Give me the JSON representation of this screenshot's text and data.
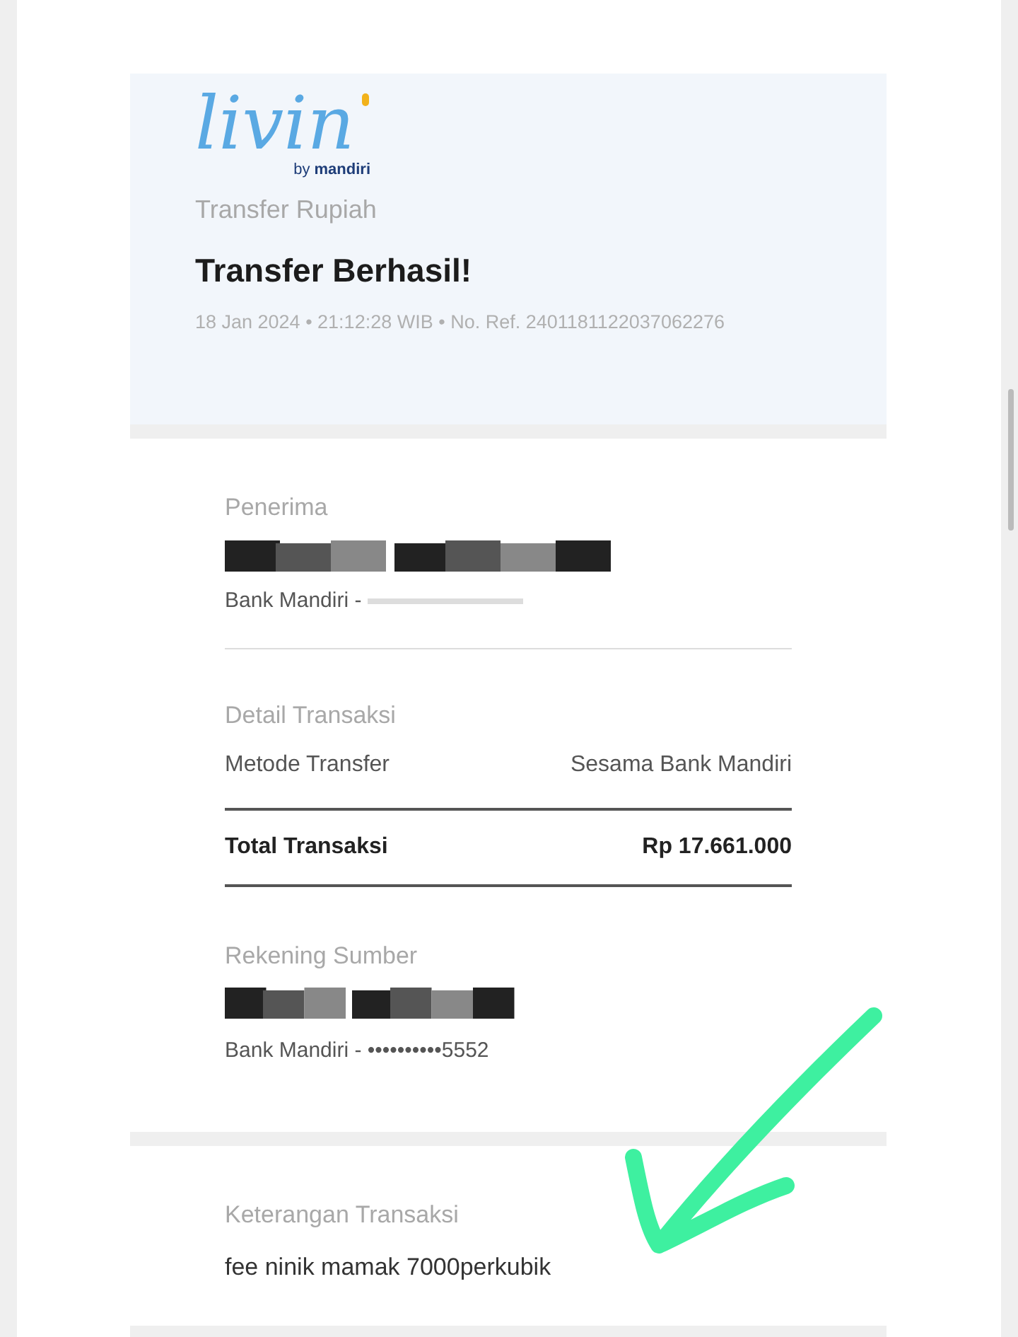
{
  "logo": {
    "wordmark": "livin",
    "byline_prefix": "by",
    "byline_brand": "mandiri"
  },
  "header": {
    "category": "Transfer Rupiah",
    "title": "Transfer Berhasil!",
    "meta": "18 Jan 2024 • 21:12:28 WIB • No. Ref. 2401181122037062276"
  },
  "recipient": {
    "label": "Penerima",
    "bank": "Bank Mandiri -"
  },
  "details": {
    "label": "Detail Transaksi",
    "rows": [
      {
        "kind": "normal",
        "label": "Metode Transfer",
        "value": "Sesama Bank Mandiri"
      },
      {
        "kind": "total",
        "label": "Total Transaksi",
        "value": "Rp 17.661.000"
      }
    ]
  },
  "source": {
    "label": "Rekening Sumber",
    "account": "Bank Mandiri - ••••••••••5552"
  },
  "note": {
    "label": "Keterangan Transaksi",
    "text": "fee ninik mamak 7000perkubik"
  }
}
